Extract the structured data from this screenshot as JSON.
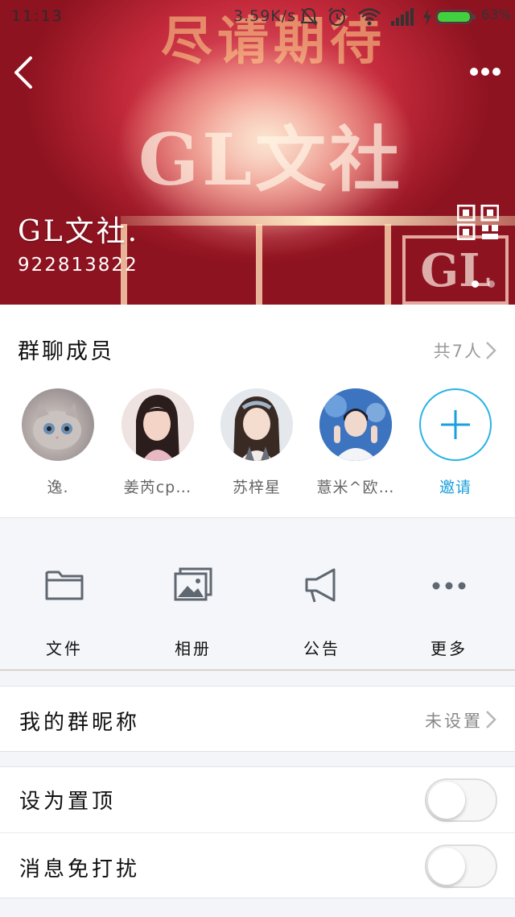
{
  "status_bar": {
    "time": "11:13",
    "net_speed": "3.59K/s",
    "battery": "63%",
    "icons": [
      "mute-bell-icon",
      "alarm-icon",
      "wifi-icon",
      "signal-icon",
      "charging-icon",
      "battery-icon"
    ]
  },
  "header": {
    "back_icon": "chevron-left-icon",
    "more_icon": "more-dots-icon",
    "group_name": "GL文社.",
    "group_id": "922813822",
    "qr_icon": "qr-code-icon",
    "banner_text": {
      "top": "尽请期待",
      "logo": "GL文社",
      "corner": "GL"
    },
    "page_dots": {
      "count": 2,
      "active": 0
    }
  },
  "members": {
    "title": "群聊成员",
    "count_label": "共7人",
    "list": [
      {
        "nick": "逸.",
        "avatar": "cat-avatar"
      },
      {
        "nick": "姜芮cp…",
        "avatar": "girl-avatar-1"
      },
      {
        "nick": "苏梓星",
        "avatar": "girl-avatar-2"
      },
      {
        "nick": "薏米^欧…",
        "avatar": "boy-avatar"
      }
    ],
    "invite_label": "邀请",
    "invite_icon": "plus-icon"
  },
  "tools": [
    {
      "label": "文件",
      "icon": "folder-icon"
    },
    {
      "label": "相册",
      "icon": "album-icon"
    },
    {
      "label": "公告",
      "icon": "megaphone-icon"
    },
    {
      "label": "更多",
      "icon": "more-dots-icon"
    }
  ],
  "settings": {
    "nickname": {
      "label": "我的群昵称",
      "value": "未设置"
    },
    "pin_top": {
      "label": "设为置顶",
      "on": false
    },
    "mute": {
      "label": "消息免打扰",
      "on": false
    }
  },
  "colors": {
    "accent": "#1aa0dc",
    "icon_gray": "#5f6770",
    "banner_red": "#c42a3b"
  }
}
